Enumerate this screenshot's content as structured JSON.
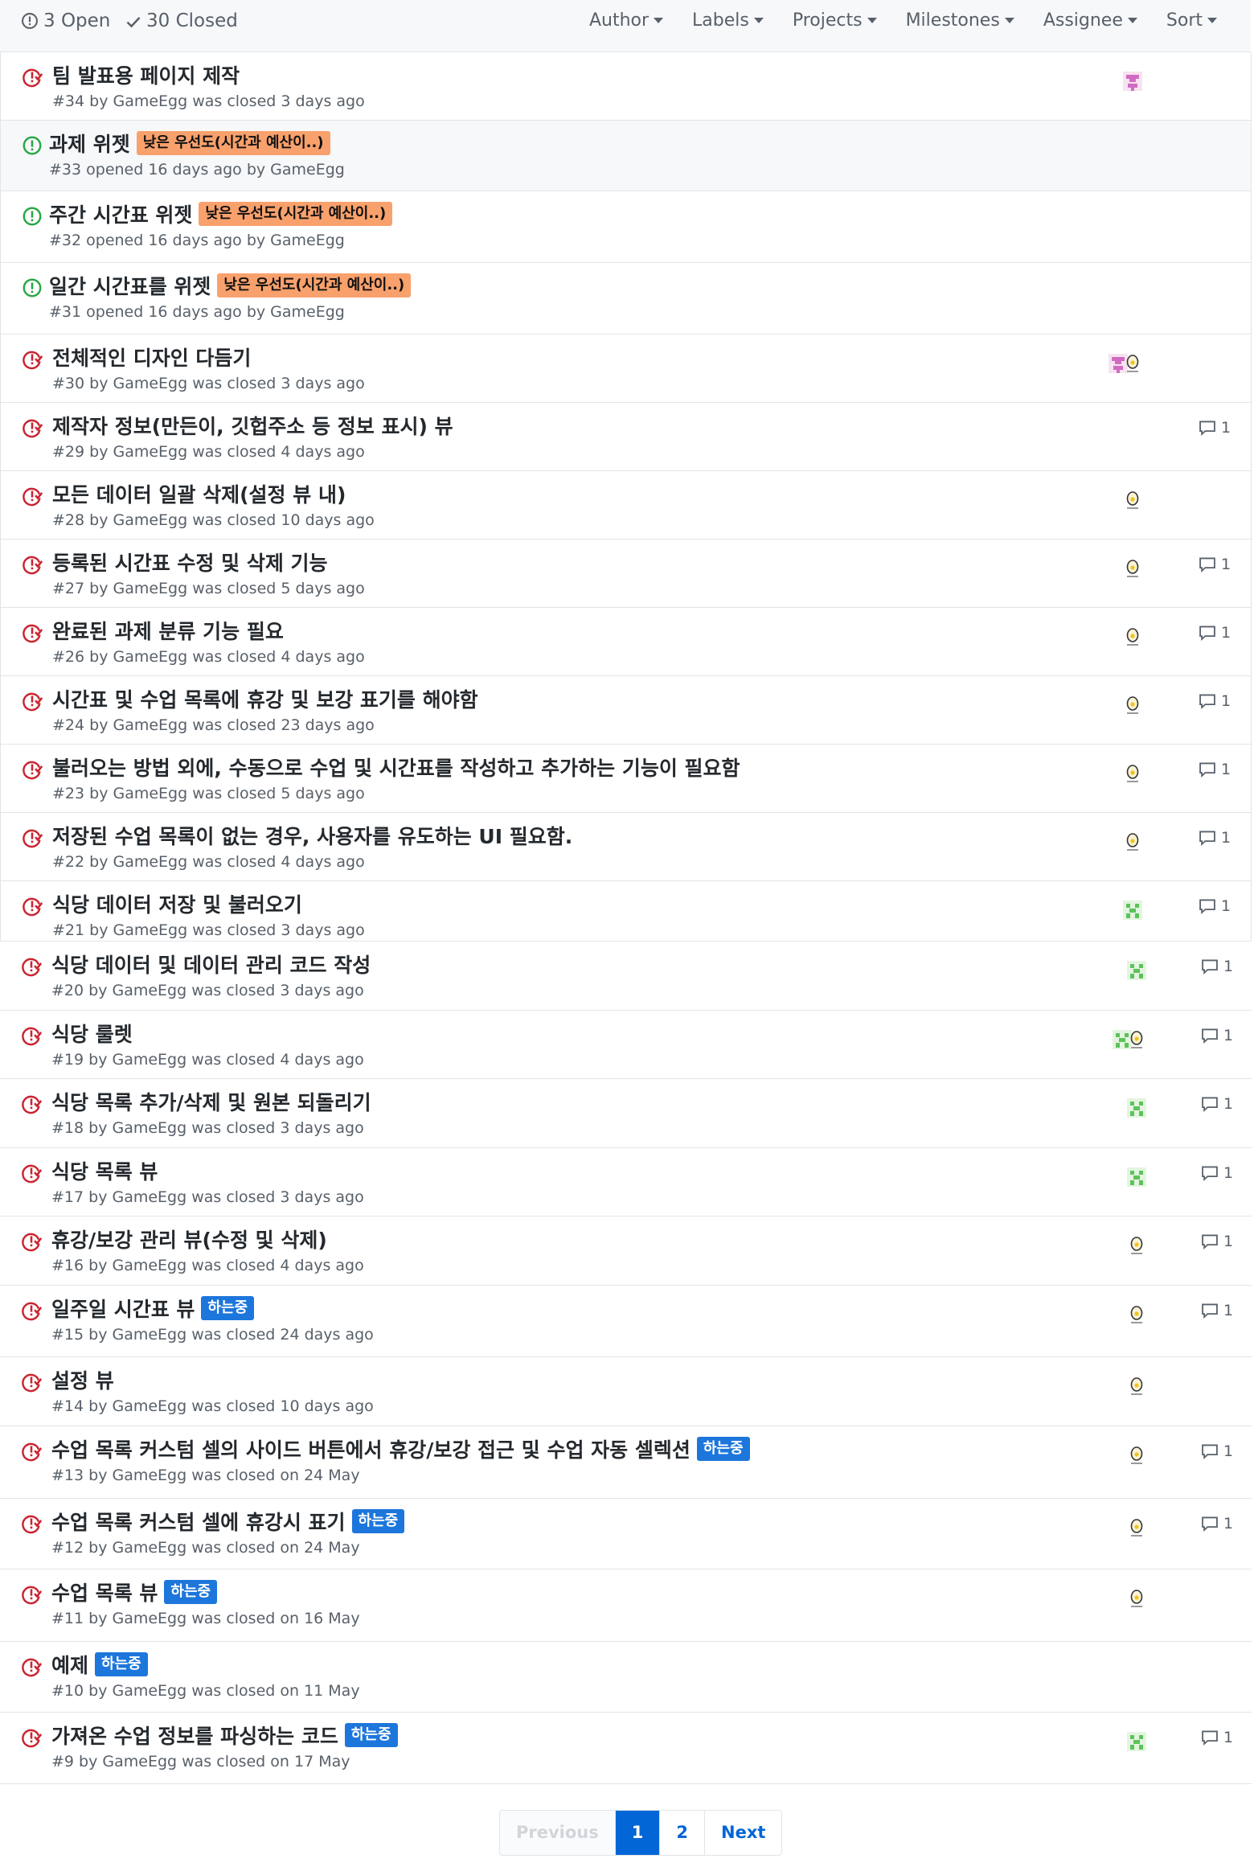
{
  "header": {
    "open_label": "3 Open",
    "closed_label": "30 Closed",
    "filters": [
      "Author",
      "Labels",
      "Projects",
      "Milestones",
      "Assignee",
      "Sort"
    ]
  },
  "colors": {
    "closed_icon": "#cb2431",
    "open_icon": "#28a745",
    "label_low_priority": "#f9a16c",
    "label_in_progress": "#1d76db",
    "link_blue": "#0366d6"
  },
  "issues": [
    {
      "title": "팀 발표용 페이지 제작",
      "meta": "#34 by GameEgg was closed 3 days ago",
      "state": "closed",
      "label": "",
      "avatar": "pink",
      "comments": ""
    },
    {
      "title": "과제 위젯",
      "meta": "#33 opened 16 days ago by GameEgg",
      "state": "open",
      "label": "낮은 우선도(시간과 예산이..)",
      "avatar": "",
      "comments": ""
    },
    {
      "title": "주간 시간표 위젯",
      "meta": "#32 opened 16 days ago by GameEgg",
      "state": "open",
      "label": "낮은 우선도(시간과 예산이..)",
      "avatar": "",
      "comments": ""
    },
    {
      "title": "일간 시간표를 위젯",
      "meta": "#31 opened 16 days ago by GameEgg",
      "state": "open",
      "label": "낮은 우선도(시간과 예산이..)",
      "avatar": "",
      "comments": ""
    },
    {
      "title": "전체적인 디자인 다듬기",
      "meta": "#30 by GameEgg was closed 3 days ago",
      "state": "closed",
      "label": "",
      "avatar": "pink+egg",
      "comments": ""
    },
    {
      "title": "제작자 정보(만든이, 깃헙주소 등 정보 표시) 뷰",
      "meta": "#29 by GameEgg was closed 4 days ago",
      "state": "closed",
      "label": "",
      "avatar": "",
      "comments": "1"
    },
    {
      "title": "모든 데이터 일괄 삭제(설정 뷰 내)",
      "meta": "#28 by GameEgg was closed 10 days ago",
      "state": "closed",
      "label": "",
      "avatar": "egg",
      "comments": ""
    },
    {
      "title": "등록된 시간표 수정 및 삭제 기능",
      "meta": "#27 by GameEgg was closed 5 days ago",
      "state": "closed",
      "label": "",
      "avatar": "egg",
      "comments": "1"
    },
    {
      "title": "완료된 과제 분류 기능 필요",
      "meta": "#26 by GameEgg was closed 4 days ago",
      "state": "closed",
      "label": "",
      "avatar": "egg",
      "comments": "1"
    },
    {
      "title": "시간표 및 수업 목록에 휴강 및 보강 표기를 해야함",
      "meta": "#24 by GameEgg was closed 23 days ago",
      "state": "closed",
      "label": "",
      "avatar": "egg",
      "comments": "1"
    },
    {
      "title": "불러오는 방법 외에, 수동으로 수업 및 시간표를 작성하고 추가하는 기능이 필요함",
      "meta": "#23 by GameEgg was closed 5 days ago",
      "state": "closed",
      "label": "",
      "avatar": "egg",
      "comments": "1"
    },
    {
      "title": "저장된 수업 목록이 없는 경우, 사용자를 유도하는 UI 필요함.",
      "meta": "#22 by GameEgg was closed 4 days ago",
      "state": "closed",
      "label": "",
      "avatar": "egg",
      "comments": "1"
    },
    {
      "title": "식당 데이터 저장 및 불러오기",
      "meta": "#21 by GameEgg was closed 3 days ago",
      "state": "closed",
      "label": "",
      "avatar": "green",
      "comments": "1"
    },
    {
      "title": "식당 데이터 및 데이터 관리 코드 작성",
      "meta": "#20 by GameEgg was closed 3 days ago",
      "state": "closed",
      "label": "",
      "avatar": "green",
      "comments": "1"
    },
    {
      "title": "식당 룰렛",
      "meta": "#19 by GameEgg was closed 4 days ago",
      "state": "closed",
      "label": "",
      "avatar": "green+egg",
      "comments": "1"
    },
    {
      "title": "식당 목록 추가/삭제 및 원본 되돌리기",
      "meta": "#18 by GameEgg was closed 3 days ago",
      "state": "closed",
      "label": "",
      "avatar": "green",
      "comments": "1"
    },
    {
      "title": "식당 목록 뷰",
      "meta": "#17 by GameEgg was closed 3 days ago",
      "state": "closed",
      "label": "",
      "avatar": "green",
      "comments": "1"
    },
    {
      "title": "휴강/보강 관리 뷰(수정 및 삭제)",
      "meta": "#16 by GameEgg was closed 4 days ago",
      "state": "closed",
      "label": "",
      "avatar": "egg",
      "comments": "1"
    },
    {
      "title": "일주일 시간표 뷰",
      "meta": "#15 by GameEgg was closed 24 days ago",
      "state": "closed",
      "label": "하는중",
      "avatar": "egg",
      "comments": "1"
    },
    {
      "title": "설정 뷰",
      "meta": "#14 by GameEgg was closed 10 days ago",
      "state": "closed",
      "label": "",
      "avatar": "egg",
      "comments": ""
    },
    {
      "title": "수업 목록 커스텀 셀의 사이드 버튼에서 휴강/보강 접근 및 수업 자동 셀렉션",
      "meta": "#13 by GameEgg was closed on 24 May",
      "state": "closed",
      "label": "하는중",
      "avatar": "egg",
      "comments": "1"
    },
    {
      "title": "수업 목록 커스텀 셀에 휴강시 표기",
      "meta": "#12 by GameEgg was closed on 24 May",
      "state": "closed",
      "label": "하는중",
      "avatar": "egg",
      "comments": "1"
    },
    {
      "title": "수업 목록 뷰",
      "meta": "#11 by GameEgg was closed on 16 May",
      "state": "closed",
      "label": "하는중",
      "avatar": "egg",
      "comments": ""
    },
    {
      "title": "예제",
      "meta": "#10 by GameEgg was closed on 11 May",
      "state": "closed",
      "label": "하는중",
      "avatar": "",
      "comments": ""
    },
    {
      "title": "가져온 수업 정보를 파싱하는 코드",
      "meta": "#9 by GameEgg was closed on 17 May",
      "state": "closed",
      "label": "하는중",
      "avatar": "green",
      "comments": "1"
    }
  ],
  "pagination": {
    "previous": "Previous",
    "pages": [
      "1",
      "2"
    ],
    "current": "1",
    "next": "Next"
  }
}
